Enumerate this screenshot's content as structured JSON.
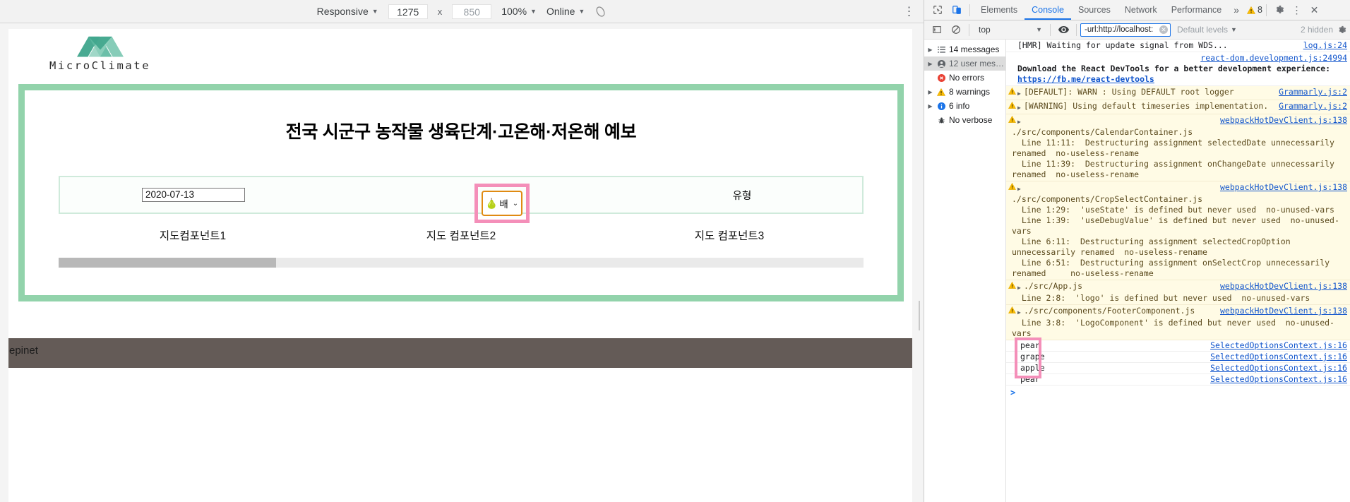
{
  "device_toolbar": {
    "device": "Responsive",
    "width": "1275",
    "height": "850",
    "zoom": "100%",
    "throttling": "Online",
    "no_throttle_icon": "no-throttling-icon",
    "kebab": "⋮"
  },
  "page": {
    "logo_text": "MicroClimate",
    "title": "전국 시군구 농작물 생육단계·고온해·저온해 예보",
    "date_value": "2020-07-13",
    "crop_select": {
      "emoji": "🍐",
      "label": "배",
      "arrow": "⌄"
    },
    "type_label": "유형",
    "map_labels": [
      "지도컴포넌트1",
      "지도 컴포넌트2",
      "지도 컴포넌트3"
    ],
    "footer_text": "epinet",
    "accent_green": "#92d3ab",
    "footer_color": "#645b57",
    "highlight_pink": "#f48fb9",
    "focus_orange": "#e08a12"
  },
  "devtools": {
    "tabs": [
      {
        "label": "Elements",
        "active": false
      },
      {
        "label": "Console",
        "active": true
      },
      {
        "label": "Sources",
        "active": false
      },
      {
        "label": "Network",
        "active": false
      },
      {
        "label": "Performance",
        "active": false
      }
    ],
    "more_tabs": "»",
    "warning_badge": "8",
    "settings_icon": "gear-icon",
    "kebab_icon": "⋮",
    "close_icon": "✕",
    "console_toolbar": {
      "context": "top",
      "eye_icon": "eye-icon",
      "filter_value": "-url:http://localhost:",
      "filter_clear": "✕",
      "levels": "Default levels",
      "hidden": "2 hidden",
      "settings_icon": "gear-icon"
    },
    "sidebar": [
      {
        "label": "14 messages",
        "icon": "list-icon",
        "expandable": true,
        "selected": false
      },
      {
        "label": "12 user mes…",
        "icon": "user-icon",
        "expandable": true,
        "selected": true
      },
      {
        "label": "No errors",
        "icon": "error-icon",
        "expandable": false,
        "selected": false
      },
      {
        "label": "8 warnings",
        "icon": "warning-icon",
        "expandable": true,
        "selected": false
      },
      {
        "label": "6 info",
        "icon": "info-icon",
        "expandable": true,
        "selected": false
      },
      {
        "label": "No verbose",
        "icon": "bug-icon",
        "expandable": false,
        "selected": false
      }
    ],
    "logs": [
      {
        "kind": "plain",
        "text": "[HMR] Waiting for update signal from WDS...",
        "source": "log.js:24"
      },
      {
        "kind": "react",
        "source": "react-dom.development.js:24994",
        "text": "Download the React DevTools for a better development experience:",
        "link": "https://fb.me/react-devtools"
      },
      {
        "kind": "warn",
        "text": "[DEFAULT]: WARN : Using DEFAULT root logger",
        "source": "Grammarly.js:2"
      },
      {
        "kind": "warn",
        "text": "[WARNING] Using default timeseries implementation.",
        "source": "Grammarly.js:2"
      },
      {
        "kind": "warn",
        "text": "./src/components/CalendarContainer.js\n  Line 11:11:  Destructuring assignment selectedDate unnecessarily renamed  no-useless-rename\n  Line 11:39:  Destructuring assignment onChangeDate unnecessarily renamed  no-useless-rename",
        "source": "webpackHotDevClient.js:138"
      },
      {
        "kind": "warn",
        "text": "./src/components/CropSelectContainer.js\n  Line 1:29:  'useState' is defined but never used  no-unused-vars\n  Line 1:39:  'useDebugValue' is defined but never used  no-unused-vars\n  Line 6:11:  Destructuring assignment selectedCropOption unnecessarily renamed  no-useless-rename\n  Line 6:51:  Destructuring assignment onSelectCrop unnecessarily renamed     no-useless-rename",
        "source": "webpackHotDevClient.js:138"
      },
      {
        "kind": "warn",
        "text": "./src/App.js\n  Line 2:8:  'logo' is defined but never used  no-unused-vars",
        "source": "webpackHotDevClient.js:138"
      },
      {
        "kind": "warn",
        "text": "./src/components/FooterComponent.js\n  Line 3:8:  'LogoComponent' is defined but never used  no-unused-vars",
        "source": "webpackHotDevClient.js:138"
      }
    ],
    "selected_options": [
      {
        "text": "pear",
        "source": "SelectedOptionsContext.js:16"
      },
      {
        "text": "grape",
        "source": "SelectedOptionsContext.js:16"
      },
      {
        "text": "apple",
        "source": "SelectedOptionsContext.js:16"
      },
      {
        "text": "pear",
        "source": "SelectedOptionsContext.js:16"
      }
    ],
    "prompt": ">"
  }
}
